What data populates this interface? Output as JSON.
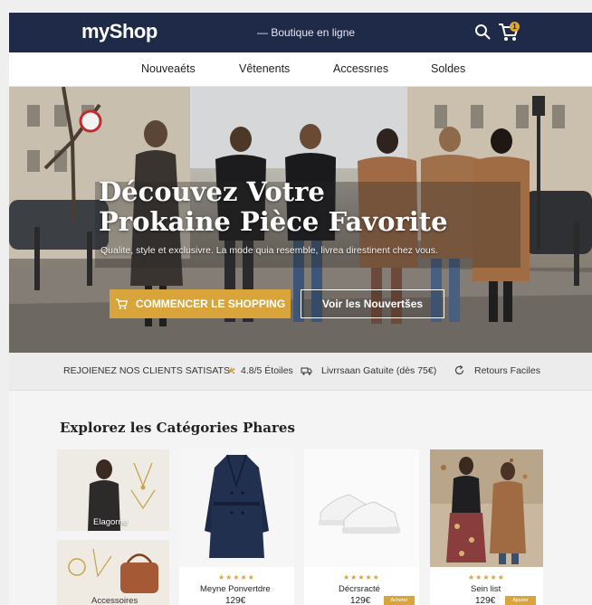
{
  "header": {
    "logo": "myShop",
    "tagline": "— Boutique en ligne",
    "cart_count": "1"
  },
  "nav": {
    "items": [
      "Nouveaéts",
      "Vêtenents",
      "Accessrıes",
      "Soldes"
    ]
  },
  "hero": {
    "title_line1": "Découvez Votre",
    "title_line2": "Prokaine Pièce Favorite",
    "subtitle": "Qualite, style et exclusivre. La mode quia resemble, livrea direstinent chez vous.",
    "primary_cta": "COMMENCER LE SHOPPING",
    "secondary_cta": "Voir les Nouvertšes"
  },
  "trust": {
    "clients": "REJOIENEZ NOS CLIENTS SATISATS :",
    "rating": "4.8/5 Étoiles",
    "delivery": "Livrrsaan Gatuite (dès 75€)",
    "returns": "Retours Faciles"
  },
  "categories": {
    "title": "Explorez les Catégories Phares",
    "items": [
      {
        "caption": "Elagorne"
      },
      {
        "caption": "Accessoires"
      }
    ]
  },
  "products": [
    {
      "stars": "★★★★★",
      "name": "Meyne Ponvertdre",
      "price": "129€"
    },
    {
      "stars": "★★★★★",
      "name": "Décrsracté",
      "price": "129€",
      "button": "Acheter"
    },
    {
      "stars": "★★★★★",
      "name": "Sein list",
      "price": "129€",
      "button": "Ajouter"
    }
  ],
  "colors": {
    "header_bg": "#1f2a48",
    "accent": "#d9a53a"
  }
}
